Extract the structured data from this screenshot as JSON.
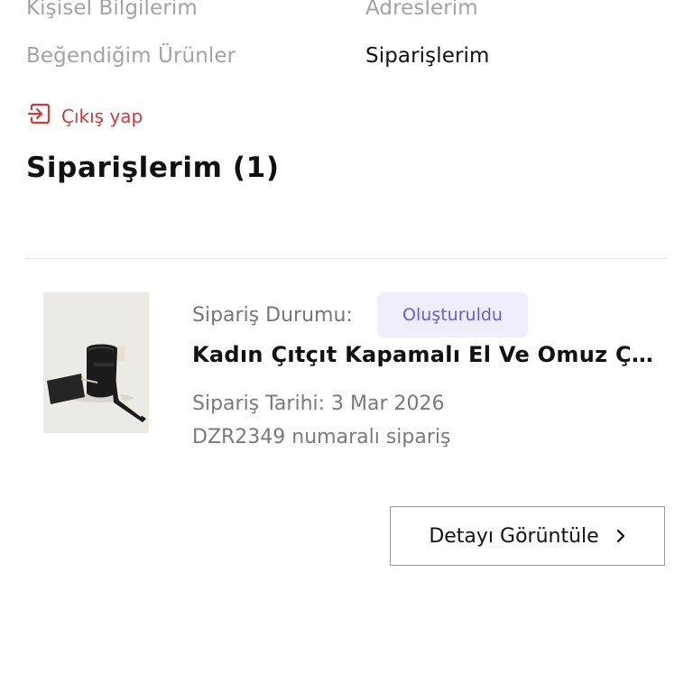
{
  "account_menu": {
    "items": [
      {
        "label": "Kişisel Bilgilerim"
      },
      {
        "label": "Adreslerim"
      },
      {
        "label": "Beğendiğim Ürünler"
      },
      {
        "label": "Siparişlerim"
      }
    ],
    "active_item": "Siparişlerim"
  },
  "logout": {
    "label": "Çıkış yap",
    "icon": "logout-icon",
    "color": "#d03b3b"
  },
  "orders_section": {
    "title": "Siparişlerim (1)"
  },
  "order": {
    "image_alt": "black bucket bag product photo",
    "status_label": "Sipariş Durumu:",
    "status_value": "Oluşturuldu",
    "product_name": "Kadın Çıtçıt Kapamalı El Ve Omuz Çantası",
    "date_text": "Sipariş Tarihi: 3 Mar 2026",
    "number_text": "DZR2349 numaralı sipariş",
    "detail_button_label": "Detayı Görüntüle",
    "detail_button_icon": "chevron-right-icon"
  },
  "colors": {
    "accent_status": "#6b5bd6",
    "status_bg": "#f0eefc",
    "danger": "#d03b3b",
    "muted_text": "#a3a3a3"
  }
}
